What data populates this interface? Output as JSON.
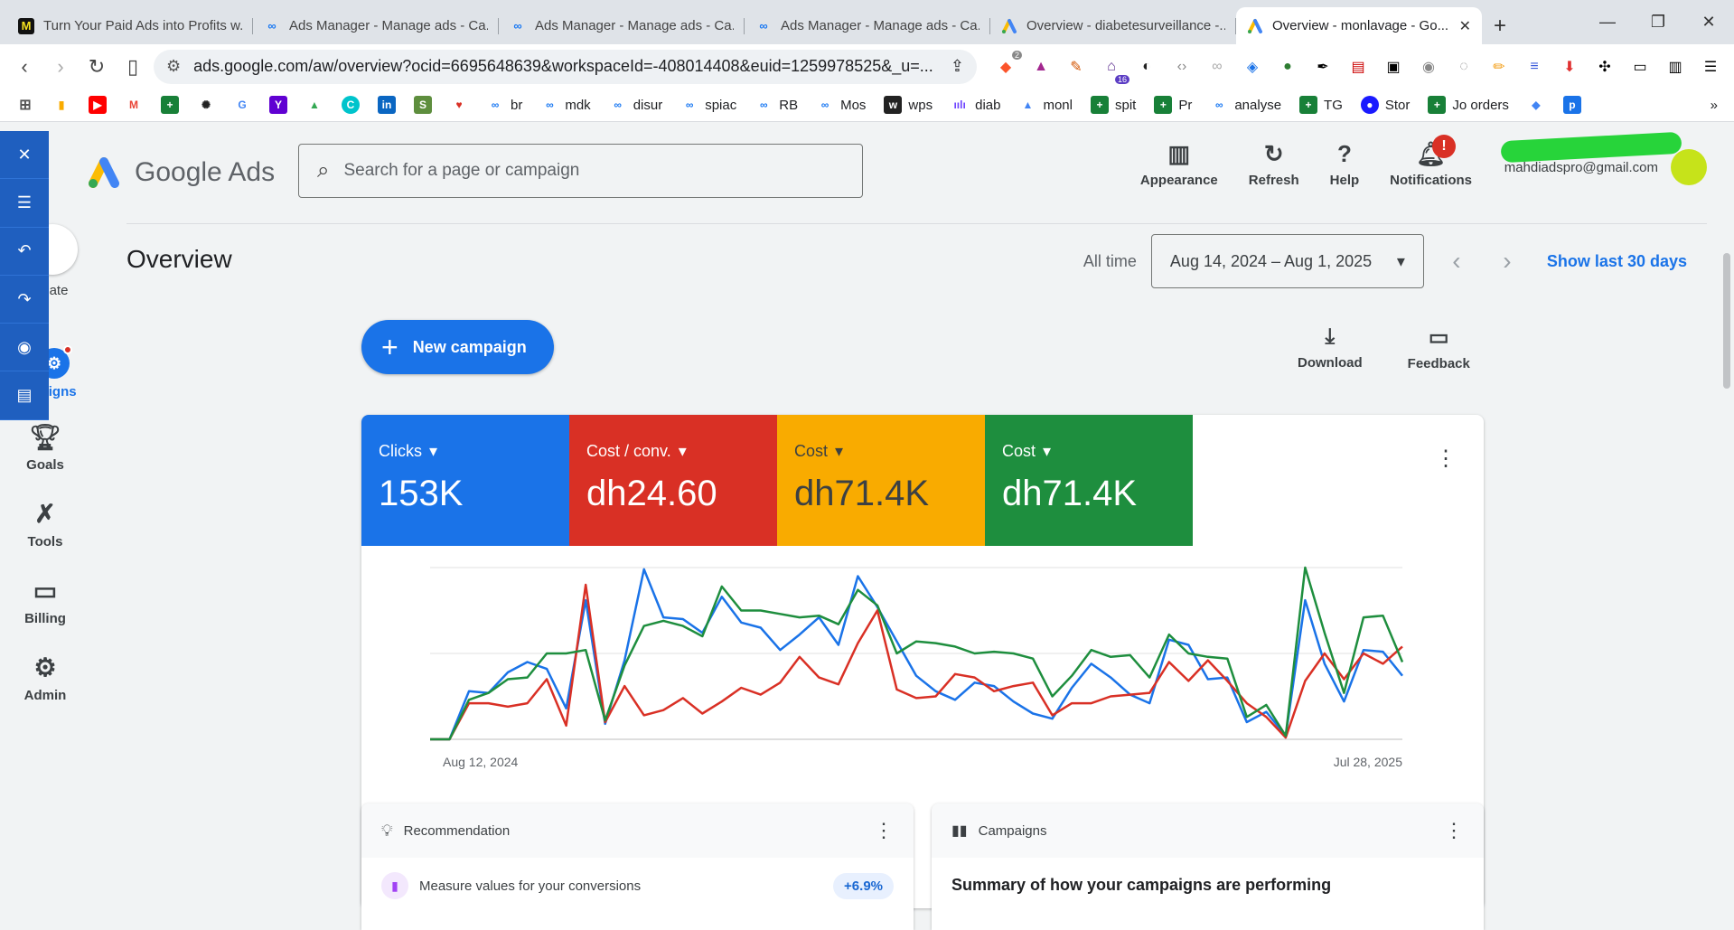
{
  "browser": {
    "tabs": [
      {
        "title": "Turn Your Paid Ads into Profits w...",
        "icon": "m-badge-icon",
        "color": "#000000"
      },
      {
        "title": "Ads Manager - Manage ads - Ca...",
        "icon": "meta-icon",
        "color": "#1877f2"
      },
      {
        "title": "Ads Manager - Manage ads - Ca...",
        "icon": "meta-icon",
        "color": "#1877f2"
      },
      {
        "title": "Ads Manager - Manage ads - Ca...",
        "icon": "meta-icon",
        "color": "#1877f2"
      },
      {
        "title": "Overview - diabetesurveillance -...",
        "icon": "google-ads-icon",
        "color": "#4285f4"
      },
      {
        "title": "Overview - monlavage - Go...",
        "icon": "google-ads-icon",
        "color": "#4285f4",
        "active": true
      }
    ],
    "url": "ads.google.com/aw/overview?ocid=6695648639&workspaceId=-408014408&euid=1259978525&_u=...",
    "extension_badges": {
      "brave_count": "2",
      "ext_count": "16"
    },
    "bookmarks": [
      "br",
      "mdk",
      "disur",
      "spiac",
      "RB",
      "Mos",
      "wps",
      "diab",
      "monl",
      "spit",
      "Pr",
      "analyse",
      "TG",
      "Stor",
      "Jo orders"
    ]
  },
  "header": {
    "product_word": "Google Ads",
    "search_placeholder": "Search for a page or campaign",
    "actions": [
      {
        "label": "Appearance",
        "icon": "appearance-icon"
      },
      {
        "label": "Refresh",
        "icon": "refresh-icon"
      },
      {
        "label": "Help",
        "icon": "help-icon"
      },
      {
        "label": "Notifications",
        "icon": "bell-icon",
        "badge": "!"
      }
    ],
    "account_email": "mahdiadspro@gmail.com"
  },
  "leftnav": {
    "items": [
      {
        "label": "ate",
        "icon": "plus-icon"
      },
      {
        "label": "aigns",
        "icon": "campaigns-icon"
      },
      {
        "label": "Goals",
        "icon": "trophy-icon"
      },
      {
        "label": "Tools",
        "icon": "tools-icon"
      },
      {
        "label": "Billing",
        "icon": "billing-icon"
      },
      {
        "label": "Admin",
        "icon": "gear-icon"
      }
    ]
  },
  "overview": {
    "title": "Overview",
    "range_label": "All time",
    "date_range": "Aug 14, 2024 – Aug 1, 2025",
    "show_last": "Show last 30 days",
    "new_campaign": "New campaign",
    "download": "Download",
    "feedback": "Feedback"
  },
  "metrics": [
    {
      "label": "Clicks",
      "value": "153K",
      "color": "#1a73e8"
    },
    {
      "label": "Cost / conv.",
      "value": "dh24.60",
      "color": "#d93025"
    },
    {
      "label": "Cost",
      "value": "dh71.4K",
      "color": "#f9ab00"
    },
    {
      "label": "Cost",
      "value": "dh71.4K",
      "color": "#1e8e3e"
    }
  ],
  "chart_data": {
    "type": "line",
    "x_start_label": "Aug 12, 2024",
    "x_end_label": "Jul 28, 2025",
    "ylim": [
      0,
      1
    ],
    "series": [
      {
        "color": "#1a73e8",
        "values": [
          0,
          0,
          0.28,
          0.27,
          0.39,
          0.45,
          0.41,
          0.18,
          0.81,
          0.09,
          0.46,
          0.99,
          0.71,
          0.7,
          0.62,
          0.83,
          0.68,
          0.65,
          0.52,
          0.61,
          0.71,
          0.55,
          0.95,
          0.77,
          0.57,
          0.37,
          0.28,
          0.23,
          0.33,
          0.31,
          0.22,
          0.15,
          0.12,
          0.3,
          0.44,
          0.36,
          0.26,
          0.21,
          0.58,
          0.55,
          0.35,
          0.36,
          0.1,
          0.16,
          0.02,
          0.81,
          0.44,
          0.22,
          0.52,
          0.51,
          0.37
        ]
      },
      {
        "color": "#d93025",
        "values": [
          0,
          0,
          0.21,
          0.21,
          0.19,
          0.21,
          0.35,
          0.08,
          0.9,
          0.1,
          0.31,
          0.14,
          0.17,
          0.24,
          0.15,
          0.22,
          0.3,
          0.26,
          0.33,
          0.48,
          0.36,
          0.32,
          0.56,
          0.75,
          0.29,
          0.24,
          0.25,
          0.38,
          0.36,
          0.28,
          0.31,
          0.33,
          0.14,
          0.21,
          0.21,
          0.25,
          0.26,
          0.27,
          0.45,
          0.34,
          0.46,
          0.34,
          0.21,
          0.13,
          0.01,
          0.34,
          0.5,
          0.35,
          0.5,
          0.44,
          0.54
        ]
      },
      {
        "color": "#1e8e3e",
        "values": [
          0,
          0,
          0.23,
          0.27,
          0.35,
          0.36,
          0.5,
          0.5,
          0.52,
          0.11,
          0.43,
          0.66,
          0.69,
          0.66,
          0.6,
          0.89,
          0.75,
          0.75,
          0.73,
          0.71,
          0.72,
          0.67,
          0.87,
          0.78,
          0.5,
          0.57,
          0.56,
          0.54,
          0.5,
          0.51,
          0.5,
          0.47,
          0.25,
          0.37,
          0.52,
          0.48,
          0.49,
          0.36,
          0.61,
          0.5,
          0.48,
          0.47,
          0.13,
          0.2,
          0.02,
          1.0,
          0.62,
          0.27,
          0.71,
          0.72,
          0.45
        ]
      }
    ]
  },
  "recommendation": {
    "title": "Recommendation",
    "item": "Measure values for your conversions",
    "change": "+6.9%"
  },
  "campaigns": {
    "title": "Campaigns",
    "summary": "Summary of how your campaigns are performing"
  }
}
